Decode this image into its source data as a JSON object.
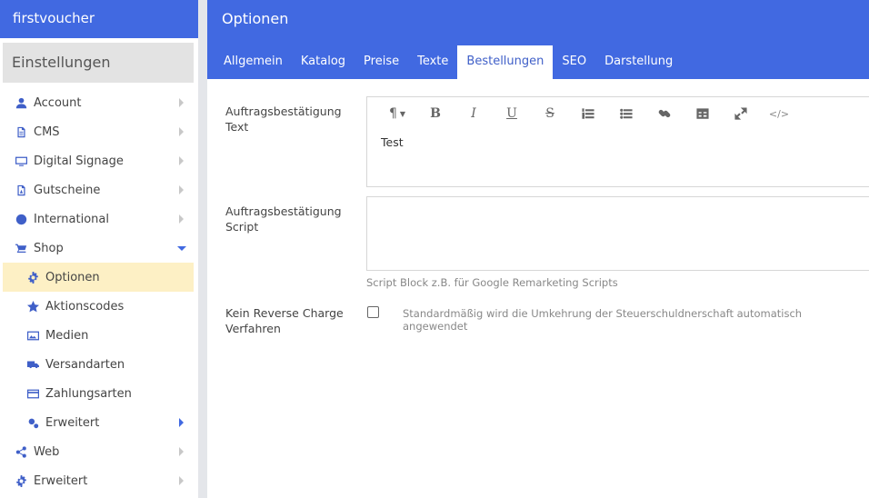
{
  "sidebar": {
    "brand": "firstvoucher",
    "section_title": "Einstellungen",
    "items": [
      {
        "label": "Account",
        "icon": "user-icon"
      },
      {
        "label": "CMS",
        "icon": "file-icon"
      },
      {
        "label": "Digital Signage",
        "icon": "monitor-icon"
      },
      {
        "label": "Gutscheine",
        "icon": "pdf-icon"
      },
      {
        "label": "International",
        "icon": "globe-icon"
      },
      {
        "label": "Shop",
        "icon": "cart-icon"
      },
      {
        "label": "Optionen",
        "icon": "gear-icon"
      },
      {
        "label": "Aktionscodes",
        "icon": "star-icon"
      },
      {
        "label": "Medien",
        "icon": "image-icon"
      },
      {
        "label": "Versandarten",
        "icon": "truck-icon"
      },
      {
        "label": "Zahlungsarten",
        "icon": "credit-card-icon"
      },
      {
        "label": "Erweitert",
        "icon": "gears-icon"
      },
      {
        "label": "Web",
        "icon": "share-icon"
      },
      {
        "label": "Erweitert",
        "icon": "gear-icon"
      }
    ]
  },
  "header": {
    "title": "Optionen",
    "tabs": [
      "Allgemein",
      "Katalog",
      "Preise",
      "Texte",
      "Bestellungen",
      "SEO",
      "Darstellung"
    ],
    "active_tab": "Bestellungen"
  },
  "form": {
    "confirmation_text_label": "Auftragsbestätigung Text",
    "editor_content": "Test",
    "confirmation_script_label": "Auftragsbestätigung Script",
    "script_value": "",
    "script_help": "Script Block z.B. für Google Remarketing Scripts",
    "reverse_charge_label": "Kein Reverse Charge Verfahren",
    "reverse_charge_checked": false,
    "reverse_charge_help": "Standardmäßig wird die Umkehrung der Steuerschuldnerschaft automatisch angewendet"
  },
  "colors": {
    "accent": "#4169e1",
    "active_nav_bg": "#fdf0c5"
  }
}
